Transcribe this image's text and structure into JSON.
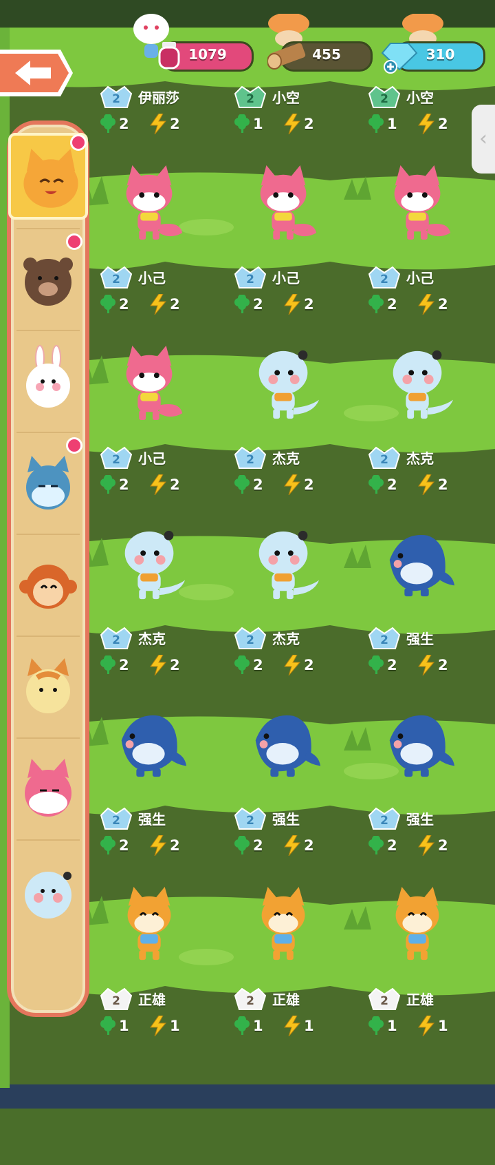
{
  "hud": {
    "ink": "1079",
    "wood": "455",
    "gems": "310"
  },
  "sidebar": {
    "items": [
      {
        "icon": "cat-icon",
        "selected": true,
        "notify": true
      },
      {
        "icon": "bear-icon",
        "selected": false,
        "notify": true
      },
      {
        "icon": "rabbit-icon",
        "selected": false,
        "notify": false
      },
      {
        "icon": "blue-cat-icon",
        "selected": false,
        "notify": true
      },
      {
        "icon": "monkey-icon",
        "selected": false,
        "notify": false
      },
      {
        "icon": "tiger-cat-icon",
        "selected": false,
        "notify": false
      },
      {
        "icon": "pink-fox-icon",
        "selected": false,
        "notify": false
      },
      {
        "icon": "otter-icon",
        "selected": false,
        "notify": false
      }
    ]
  },
  "grid": {
    "rows": [
      {
        "cards": [
          {
            "level": "2",
            "name": "伊丽莎",
            "clover": "2",
            "energy": "2",
            "creature": "fox",
            "badge": "blue"
          },
          {
            "level": "2",
            "name": "小空",
            "clover": "1",
            "energy": "2",
            "creature": "fox",
            "badge": "green"
          },
          {
            "level": "2",
            "name": "小空",
            "clover": "1",
            "energy": "2",
            "creature": "fox",
            "badge": "green"
          }
        ]
      },
      {
        "cards": [
          {
            "level": "2",
            "name": "小己",
            "clover": "2",
            "energy": "2",
            "creature": "fox",
            "badge": "blue"
          },
          {
            "level": "2",
            "name": "小己",
            "clover": "2",
            "energy": "2",
            "creature": "otter",
            "badge": "blue"
          },
          {
            "level": "2",
            "name": "小己",
            "clover": "2",
            "energy": "2",
            "creature": "otter",
            "badge": "blue"
          }
        ]
      },
      {
        "cards": [
          {
            "level": "2",
            "name": "小己",
            "clover": "2",
            "energy": "2",
            "creature": "otter",
            "badge": "blue"
          },
          {
            "level": "2",
            "name": "杰克",
            "clover": "2",
            "energy": "2",
            "creature": "otter",
            "badge": "blue"
          },
          {
            "level": "2",
            "name": "杰克",
            "clover": "2",
            "energy": "2",
            "creature": "shark",
            "badge": "blue"
          }
        ]
      },
      {
        "cards": [
          {
            "level": "2",
            "name": "杰克",
            "clover": "2",
            "energy": "2",
            "creature": "shark",
            "badge": "blue"
          },
          {
            "level": "2",
            "name": "杰克",
            "clover": "2",
            "energy": "2",
            "creature": "shark",
            "badge": "blue"
          },
          {
            "level": "2",
            "name": "强生",
            "clover": "2",
            "energy": "2",
            "creature": "shark",
            "badge": "blue"
          }
        ]
      },
      {
        "cards": [
          {
            "level": "2",
            "name": "强生",
            "clover": "2",
            "energy": "2",
            "creature": "shiba",
            "badge": "blue"
          },
          {
            "level": "2",
            "name": "强生",
            "clover": "2",
            "energy": "2",
            "creature": "shiba",
            "badge": "blue"
          },
          {
            "level": "2",
            "name": "强生",
            "clover": "2",
            "energy": "2",
            "creature": "shiba",
            "badge": "blue"
          }
        ]
      },
      {
        "cards": [
          {
            "level": "2",
            "name": "正雄",
            "clover": "1",
            "energy": "1",
            "creature": "none",
            "badge": "white"
          },
          {
            "level": "2",
            "name": "正雄",
            "clover": "1",
            "energy": "1",
            "creature": "none",
            "badge": "white"
          },
          {
            "level": "2",
            "name": "正雄",
            "clover": "1",
            "energy": "1",
            "creature": "none",
            "badge": "white"
          }
        ]
      }
    ]
  },
  "colors": {
    "grass": "#7ec83f",
    "dirt": "#4a6e2a",
    "accent_pink": "#e2497b",
    "gem_blue": "#49c7e4",
    "sidebar_bg": "#e9c88a",
    "sidebar_border": "#e4765c"
  }
}
